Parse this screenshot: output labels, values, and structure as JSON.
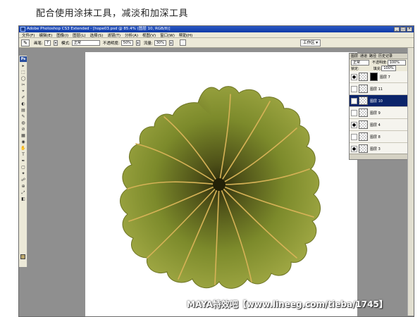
{
  "caption": "配合使用涂抹工具，减淡和加深工具",
  "window": {
    "title": "Adobe Photoshop CS3 Extended - [hope03.psd @ 85.4% (图层 10, RGB/8)]",
    "controls": [
      "_",
      "□",
      "×"
    ]
  },
  "menu": [
    "文件(F)",
    "编辑(E)",
    "图像(I)",
    "图层(L)",
    "选择(S)",
    "滤镜(T)",
    "分析(A)",
    "视图(V)",
    "窗口(W)",
    "帮助(H)"
  ],
  "options": {
    "tool_glyph": "✎",
    "brush_label": "画笔:",
    "brush_size": "7",
    "mode_label": "模式:",
    "mode_value": "正常",
    "opacity_label": "不透明度:",
    "opacity_value": "50%",
    "flow_label": "流量:",
    "flow_value": "30%",
    "workspace": "工作区 ▾"
  },
  "toolbox": {
    "badge": "Ps",
    "tools": [
      "▸",
      "⬚",
      "◯",
      "✂",
      "⌖",
      "✐",
      "◐",
      "▤",
      "✎",
      "◍",
      "⊘",
      "▦",
      "◉",
      "✋",
      "T",
      "✒",
      "▢",
      "✦",
      "☍",
      "⊕",
      "⤢",
      "◧"
    ],
    "foreground_color": "#b9a56a"
  },
  "layers_panel": {
    "tabs": [
      "图层",
      "通道",
      "路径",
      "历史记录"
    ],
    "blend_mode": "正常",
    "opacity_label": "不透明度:",
    "opacity_value": "100%",
    "lock_label": "锁定:",
    "fill_label": "填充:",
    "fill_value": "100%",
    "layers": [
      {
        "name": "图层 7",
        "visible": true,
        "has_mask": true,
        "selected": false
      },
      {
        "name": "图层 11",
        "visible": false,
        "has_mask": false,
        "selected": false
      },
      {
        "name": "图层 10",
        "visible": false,
        "has_mask": false,
        "selected": true
      },
      {
        "name": "图层 9",
        "visible": false,
        "has_mask": false,
        "selected": false
      },
      {
        "name": "图层 4",
        "visible": true,
        "has_mask": false,
        "selected": false
      },
      {
        "name": "图层 8",
        "visible": false,
        "has_mask": false,
        "selected": false
      },
      {
        "name": "图层 3",
        "visible": true,
        "has_mask": false,
        "selected": false
      }
    ]
  },
  "watermark": "MAYA特效吧【www.lineeg.com/tieba/1745】",
  "colors": {
    "leaf_dark": "#3a3a12",
    "leaf_mid": "#7d8a2a",
    "leaf_light": "#a9b04a",
    "vein": "#d8b45a",
    "selection": "#0b246a"
  }
}
